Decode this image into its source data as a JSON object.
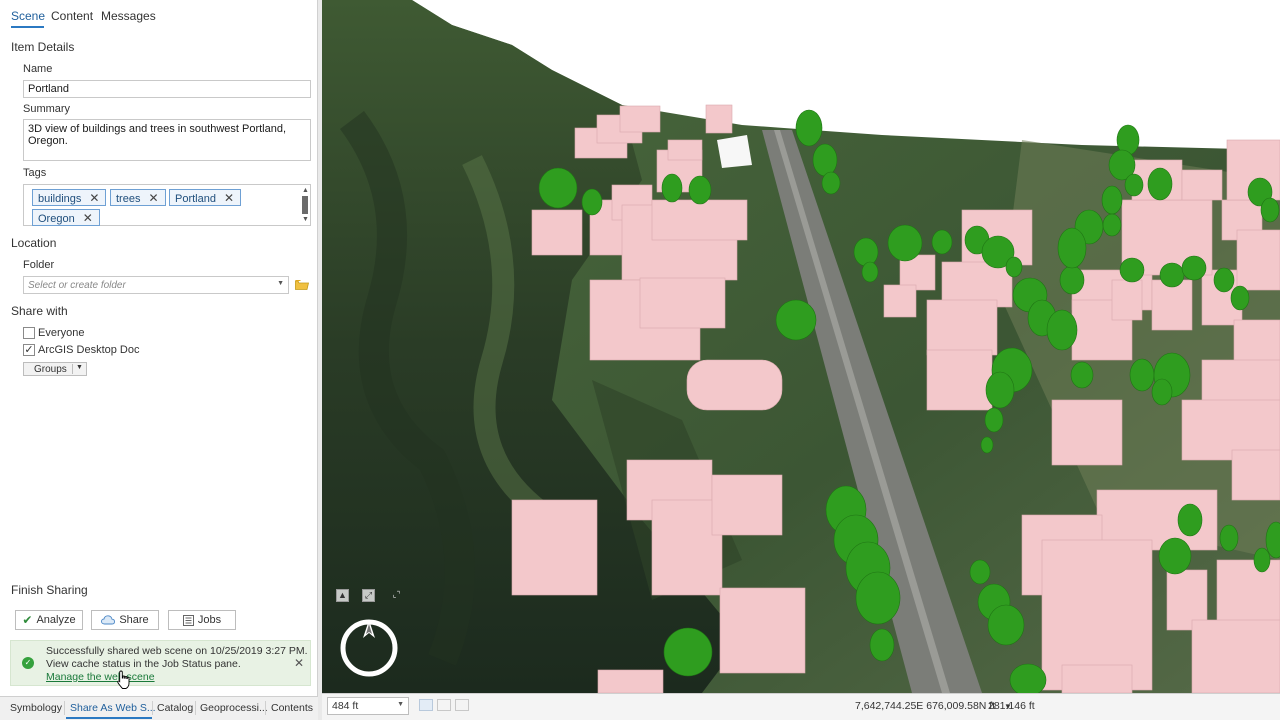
{
  "pane_tabs": [
    "Scene",
    "Content",
    "Messages"
  ],
  "item_details": {
    "section_title": "Item Details",
    "name_label": "Name",
    "name_value": "Portland",
    "summary_label": "Summary",
    "summary_value": "3D view of buildings and trees in southwest Portland, Oregon.",
    "tags_label": "Tags",
    "tags": [
      "buildings",
      "trees",
      "Portland",
      "Oregon"
    ]
  },
  "location": {
    "section_title": "Location",
    "folder_label": "Folder",
    "folder_placeholder": "Select or create folder"
  },
  "share_with": {
    "section_title": "Share with",
    "options": [
      {
        "label": "Everyone",
        "checked": false
      },
      {
        "label": "ArcGIS Desktop Doc",
        "checked": true
      }
    ],
    "groups_label": "Groups"
  },
  "finish_sharing": {
    "section_title": "Finish Sharing",
    "analyze_label": "Analyze",
    "share_label": "Share",
    "jobs_label": "Jobs"
  },
  "notification": {
    "line1": "Successfully shared web scene on 10/25/2019 3:27 PM.",
    "line2": "View cache status in the Job Status pane.",
    "link": "Manage the web scene"
  },
  "bottom_tabs": [
    "Symbology",
    "Share As Web S...",
    "Catalog",
    "Geoprocessi...",
    "Contents"
  ],
  "status_bar": {
    "scale": "484 ft",
    "coordinates": "7,642,744.25E 676,009.58N ft",
    "elevation": "281.146 ft"
  },
  "colors": {
    "accent": "#2b79c2",
    "building": "#f4c9cc",
    "tree": "#2e9a1e",
    "success": "#35a13d"
  },
  "icons": [
    "folder-icon",
    "check-icon",
    "cloud-icon",
    "jobs-icon",
    "success-icon",
    "close-icon",
    "compass-icon",
    "zoom-extent-icon",
    "fullscreen-icon",
    "collapse-icon"
  ]
}
